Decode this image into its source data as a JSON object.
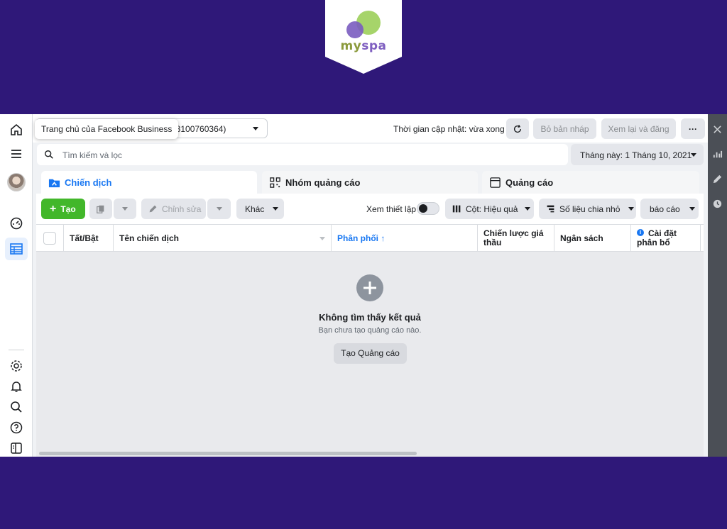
{
  "brand": {
    "logo_my": "my",
    "logo_spa": "spa",
    "colors": {
      "background": "#2f1879",
      "accent": "#1877f2",
      "create_green": "#42b72a"
    }
  },
  "header": {
    "tooltip": "Trang chủ của Facebook Business",
    "account_id": "18100760364)",
    "update_status": "Thời gian cập nhật: vừa xong",
    "discard_label": "Bỏ bản nháp",
    "review_label": "Xem lại và đăng",
    "more_label": "···"
  },
  "search": {
    "placeholder": "Tìm kiếm và lọc",
    "date_range": "Tháng này: 1 Tháng 10, 2021"
  },
  "tabs": [
    {
      "label": "Chiến dịch",
      "icon": "folder-icon",
      "active": true
    },
    {
      "label": "Nhóm quảng cáo",
      "icon": "grid-icon",
      "active": false
    },
    {
      "label": "Quảng cáo",
      "icon": "ad-icon",
      "active": false
    }
  ],
  "toolbar": {
    "create_label": "Tạo",
    "edit_label": "Chỉnh sửa",
    "more_label": "Khác",
    "setup_label": "Xem thiết lập",
    "columns_label": "Cột: Hiệu quả",
    "breakdown_label": "Số liệu chia nhỏ",
    "reports_label": "báo cáo"
  },
  "table": {
    "columns": [
      "Tất/Bật",
      "Tên chiến dịch",
      "Phân phối ↑",
      "Chiến lược giá thầu",
      "Ngân sách",
      "Cài đặt phân bổ"
    ]
  },
  "empty_state": {
    "title": "Không tìm thấy kết quả",
    "subtitle": "Bạn chưa tạo quảng cáo nào.",
    "button_label": "Tạo Quảng cáo"
  }
}
